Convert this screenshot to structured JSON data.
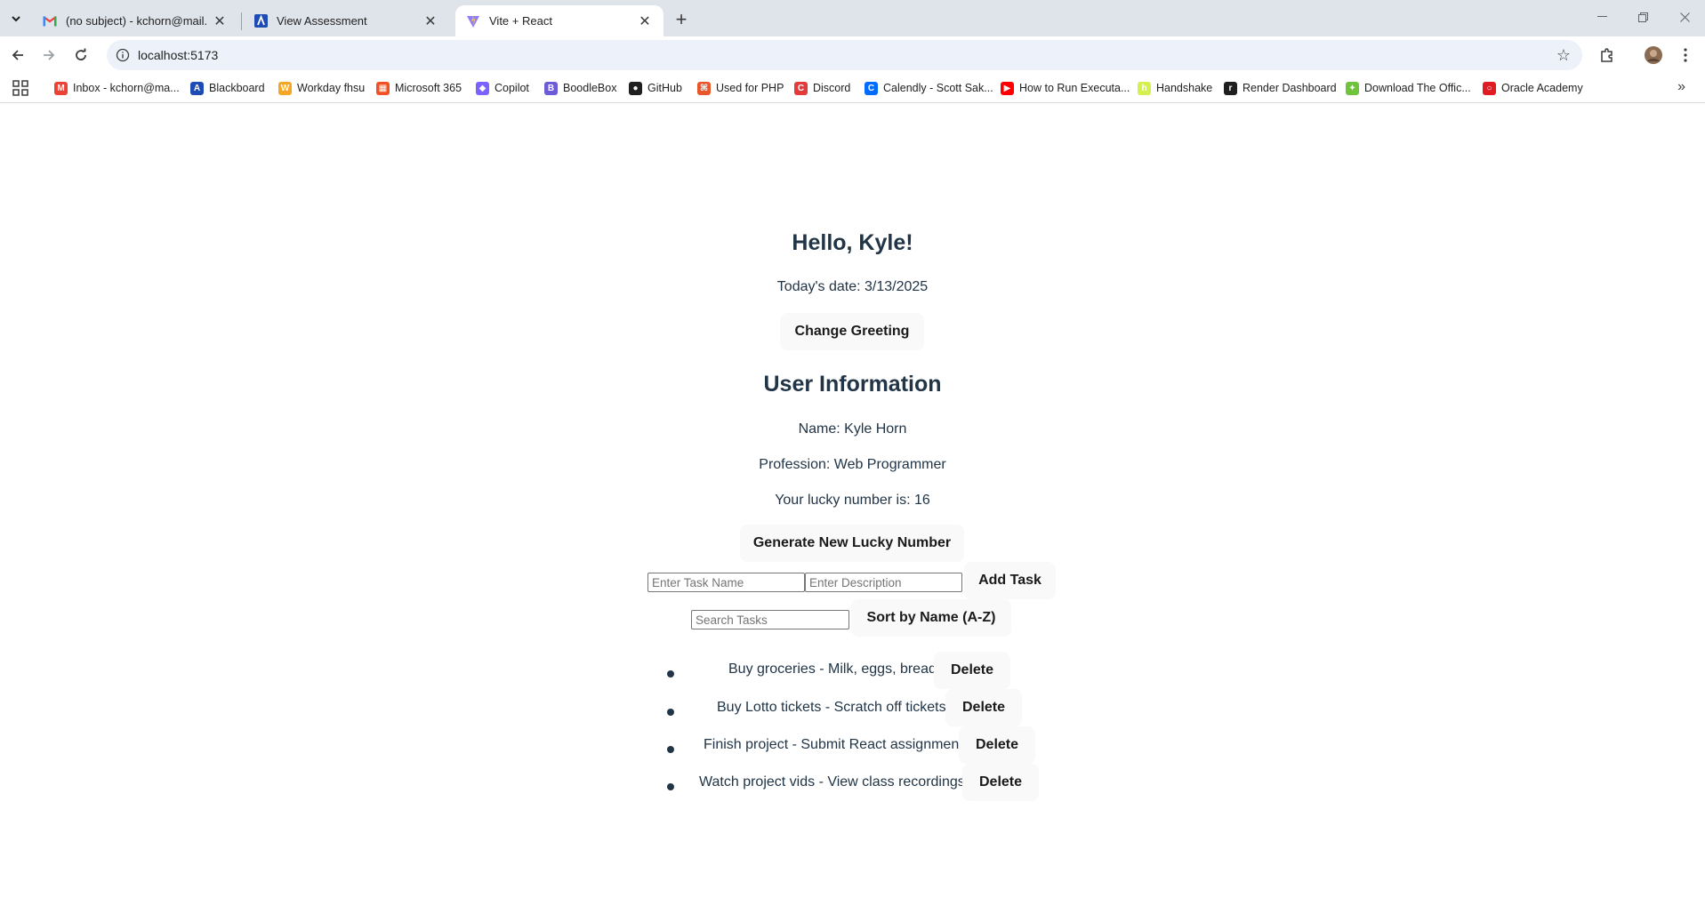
{
  "browser": {
    "tabs": [
      {
        "title": "(no subject) - kchorn@mail.fhsu",
        "icon": "gmail-icon"
      },
      {
        "title": "View Assessment",
        "icon": "blackboard-icon"
      },
      {
        "title": "Vite + React",
        "icon": "vite-icon"
      }
    ],
    "url": "localhost:5173",
    "bookmarks": [
      {
        "label": "Inbox - kchorn@ma...",
        "color": "#ea4335",
        "glyph": "M"
      },
      {
        "label": "Blackboard",
        "color": "#1f4bb5",
        "glyph": "A"
      },
      {
        "label": "Workday fhsu",
        "color": "#f5a623",
        "glyph": "W"
      },
      {
        "label": "Microsoft 365",
        "color": "#f25022",
        "glyph": "▦"
      },
      {
        "label": "Copilot",
        "color": "#7b61ff",
        "glyph": "◆"
      },
      {
        "label": "BoodleBox",
        "color": "#6b5bd6",
        "glyph": "B"
      },
      {
        "label": "GitHub",
        "color": "#1f1f1f",
        "glyph": "●"
      },
      {
        "label": "Used for PHP",
        "color": "#e8572a",
        "glyph": "⌘"
      },
      {
        "label": "Discord",
        "color": "#e33b3b",
        "glyph": "C"
      },
      {
        "label": "Calendly - Scott Sak...",
        "color": "#006bff",
        "glyph": "C"
      },
      {
        "label": "How to Run Executa...",
        "color": "#ff0000",
        "glyph": "▶"
      },
      {
        "label": "Handshake",
        "color": "#d4f04c",
        "glyph": "h"
      },
      {
        "label": "Render Dashboard",
        "color": "#1f1f1f",
        "glyph": "r"
      },
      {
        "label": "Download The Offic...",
        "color": "#6fc43a",
        "glyph": "✦"
      },
      {
        "label": "Oracle Academy",
        "color": "#e01b24",
        "glyph": "○"
      }
    ]
  },
  "app": {
    "greeting": "Hello, Kyle!",
    "date_line": "Today's date: 3/13/2025",
    "change_greeting_label": "Change Greeting",
    "user_info_heading": "User Information",
    "name_line": "Name: Kyle Horn",
    "profession_line": "Profession: Web Programmer",
    "lucky_line": "Your lucky number is: 16",
    "lucky_button_label": "Generate New Lucky Number",
    "task_name_placeholder": "Enter Task Name",
    "task_desc_placeholder": "Enter Description",
    "add_task_label": "Add Task",
    "search_placeholder": "Search Tasks",
    "sort_label": "Sort by Name (A-Z)",
    "delete_label": "Delete",
    "tasks": [
      {
        "text": "Buy groceries - Milk, eggs, bread"
      },
      {
        "text": "Buy Lotto tickets - Scratch off tickets"
      },
      {
        "text": "Finish project - Submit React assignment"
      },
      {
        "text": "Watch project vids - View class recordings"
      }
    ]
  }
}
